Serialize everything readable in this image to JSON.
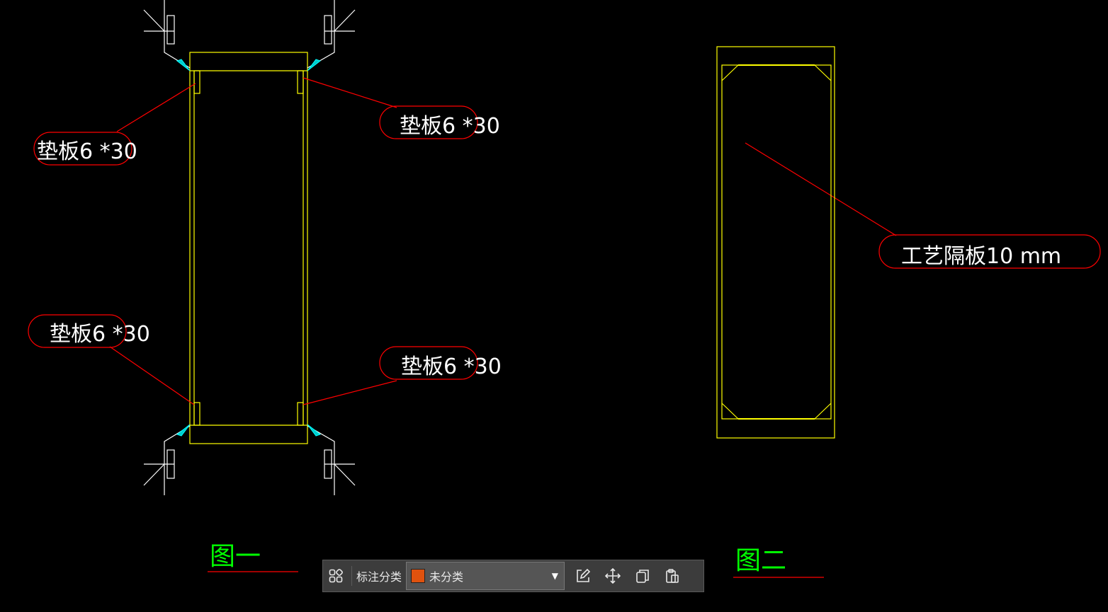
{
  "drawing": {
    "annotations": {
      "pad_top_left": "垫板6 *30",
      "pad_top_right": "垫板6 *30",
      "pad_bottom_left": "垫板6 *30",
      "pad_bottom_right": "垫板6 *30",
      "process_plate": "工艺隔板10 mm"
    },
    "figure_labels": {
      "fig1": "图一",
      "fig2": "图二"
    },
    "colors": {
      "background": "#000000",
      "outline": "#ffff00",
      "leader": "#ff0000",
      "text": "#ffffff",
      "figure_label": "#00ff00",
      "arrow": "#00ffff",
      "weld_symbol": "#ffffff"
    }
  },
  "toolbar": {
    "layout_icon": "grid-icon",
    "category_label": "标注分类",
    "category_value": "未分类",
    "category_color": "#e0520e",
    "actions": [
      "edit-icon",
      "move-icon",
      "copy-icon",
      "paste-icon"
    ]
  }
}
